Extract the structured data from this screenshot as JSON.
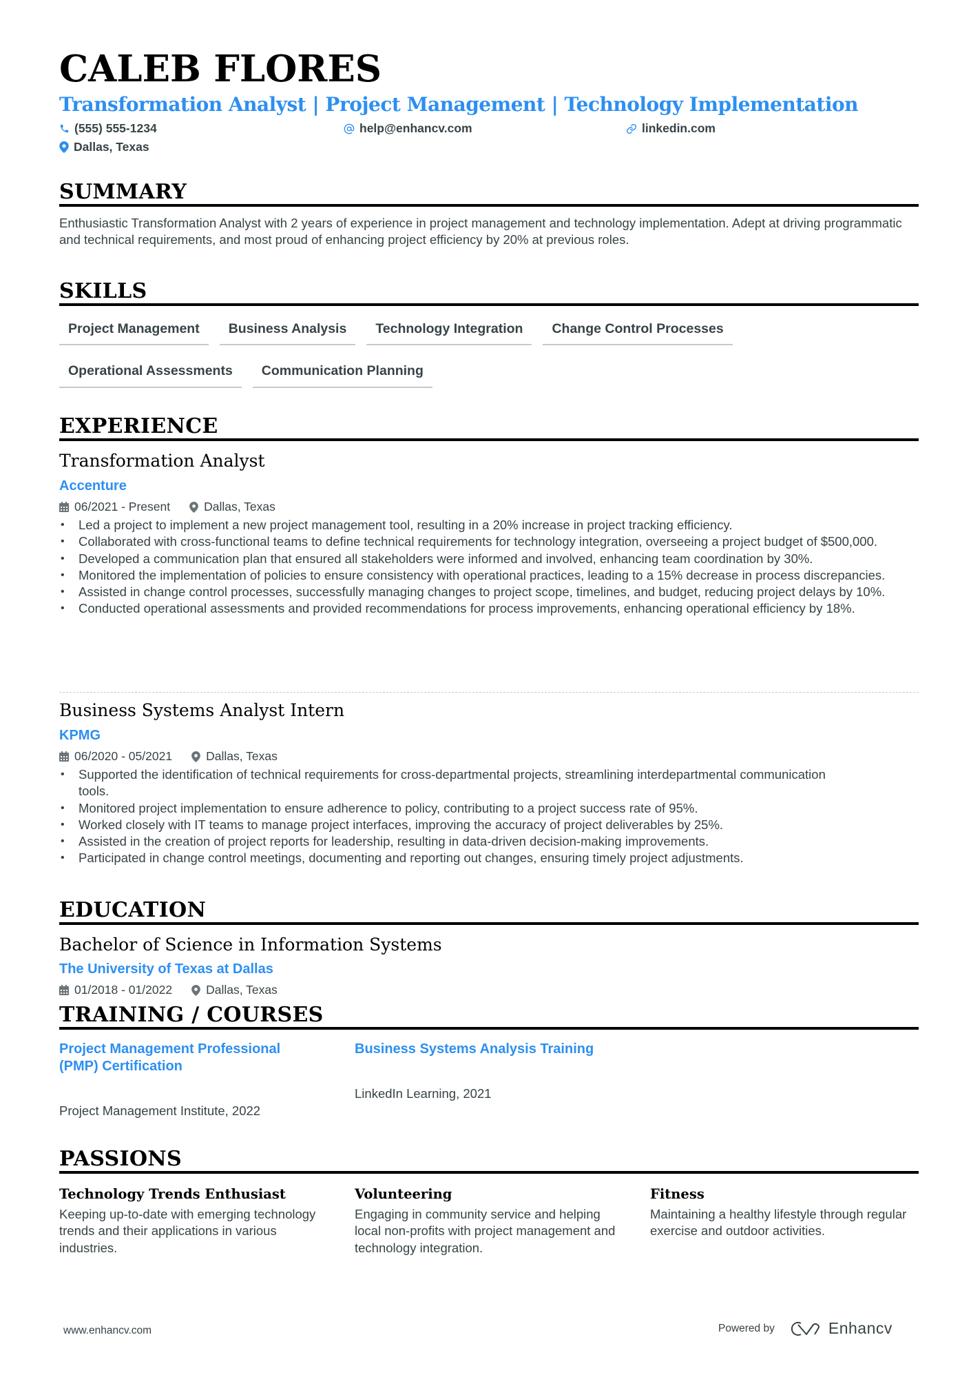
{
  "header": {
    "name": "CALEB FLORES",
    "tagline": "Transformation Analyst | Project Management | Technology Implementation",
    "contacts": {
      "phone": "(555) 555-1234",
      "email": "help@enhancv.com",
      "linkedin": "linkedin.com",
      "location": "Dallas, Texas"
    }
  },
  "summary": {
    "title": "SUMMARY",
    "text": "Enthusiastic Transformation Analyst with 2 years of experience in project management and technology implementation. Adept at driving programmatic and technical requirements, and most proud of enhancing project efficiency by 20% at previous roles."
  },
  "skills": {
    "title": "SKILLS",
    "items": [
      "Project Management",
      "Business Analysis",
      "Technology Integration",
      "Change Control Processes",
      "Operational Assessments",
      "Communication Planning"
    ]
  },
  "experience": {
    "title": "EXPERIENCE",
    "jobs": [
      {
        "role": "Transformation Analyst",
        "company": "Accenture",
        "dates": "06/2021 - Present",
        "location": "Dallas, Texas",
        "bullets": [
          "Led a project to implement a new project management tool, resulting in a 20% increase in project tracking efficiency.",
          "Collaborated with cross-functional teams to define technical requirements for technology integration, overseeing a project budget of $500,000.",
          "Developed a communication plan that ensured all stakeholders were informed and involved, enhancing team coordination by 30%.",
          "Monitored the implementation of policies to ensure consistency with operational practices, leading to a 15% decrease in process discrepancies.",
          "Assisted in change control processes, successfully managing changes to project scope, timelines, and budget, reducing project delays by 10%.",
          "Conducted operational assessments and provided recommendations for process improvements, enhancing operational efficiency by 18%."
        ]
      },
      {
        "role": "Business Systems Analyst Intern",
        "company": "KPMG",
        "dates": "06/2020 - 05/2021",
        "location": "Dallas, Texas",
        "bullets": [
          "Supported the identification of technical requirements for cross-departmental projects, streamlining interdepartmental communication tools.",
          "Monitored project implementation to ensure adherence to policy, contributing to a project success rate of 95%.",
          "Worked closely with IT teams to manage project interfaces, improving the accuracy of project deliverables by 25%.",
          "Assisted in the creation of project reports for leadership, resulting in data-driven decision-making improvements.",
          "Participated in change control meetings, documenting and reporting out changes, ensuring timely project adjustments."
        ]
      }
    ]
  },
  "education": {
    "title": "EDUCATION",
    "degree": "Bachelor of Science in Information Systems",
    "school": "The University of Texas at Dallas",
    "dates": "01/2018 - 01/2022",
    "location": "Dallas, Texas"
  },
  "training": {
    "title": "TRAINING / COURSES",
    "items": [
      {
        "title": "Project Management Professional (PMP) Certification",
        "sub": "Project Management Institute, 2022"
      },
      {
        "title": "Business Systems Analysis Training",
        "sub": "LinkedIn Learning, 2021"
      }
    ]
  },
  "passions": {
    "title": "PASSIONS",
    "items": [
      {
        "title": "Technology Trends Enthusiast",
        "desc": "Keeping up-to-date with emerging technology trends and their applications in various industries."
      },
      {
        "title": "Volunteering",
        "desc": "Engaging in community service and helping local non-profits with project management and technology integration."
      },
      {
        "title": "Fitness",
        "desc": "Maintaining a healthy lifestyle through regular exercise and outdoor activities."
      }
    ]
  },
  "footer": {
    "website": "www.enhancv.com",
    "powered_by": "Powered by",
    "brand": "Enhancv"
  },
  "colors": {
    "accent": "#2d8ff0",
    "text": "#384347",
    "heading": "#000000"
  }
}
